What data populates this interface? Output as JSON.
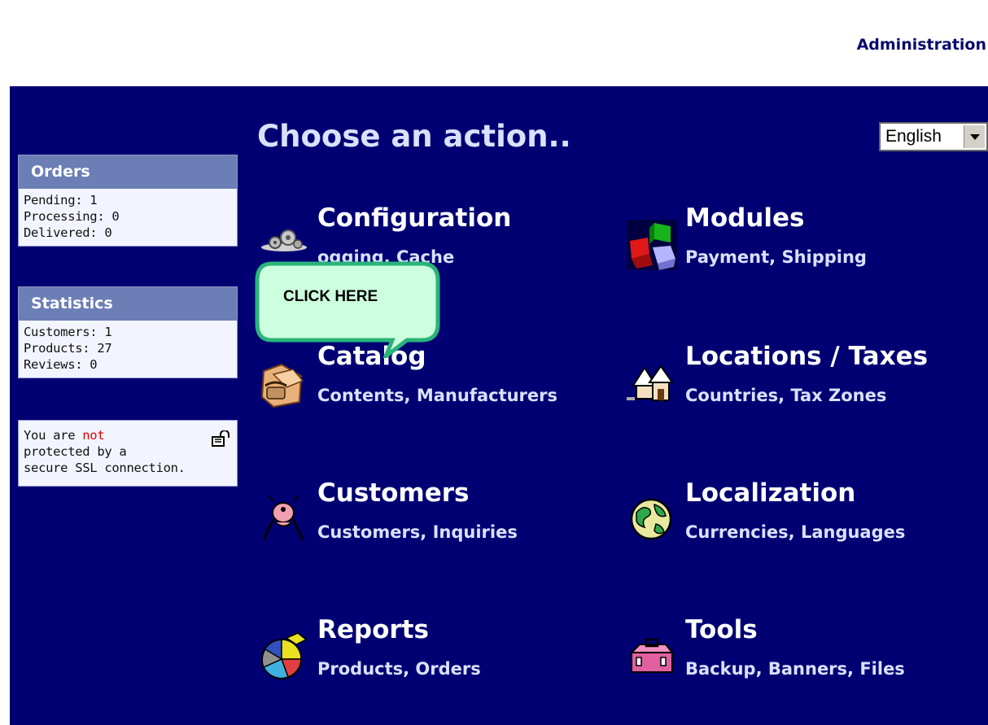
{
  "header": {
    "admin_link": "Administration"
  },
  "sidebar": {
    "orders": {
      "title": "Orders",
      "lines": [
        "Pending: 1",
        "Processing: 0",
        "Delivered: 0"
      ]
    },
    "statistics": {
      "title": "Statistics",
      "lines": [
        "Customers: 1",
        "Products: 27",
        "Reviews: 0"
      ]
    },
    "ssl": {
      "part1": "You are ",
      "not": "not",
      "part2": "protected by a",
      "part3": "secure SSL connection.",
      "icon": "unlocked-padlock-icon"
    }
  },
  "main": {
    "heading": "Choose an action..",
    "language": {
      "selected": "English"
    },
    "tooltip": "CLICK HERE",
    "actions": [
      {
        "title": "Configuration",
        "subtitle": "ogging, Cache",
        "icon": "gears-icon"
      },
      {
        "title": "Modules",
        "subtitle": "Payment, Shipping",
        "icon": "blocks-icon"
      },
      {
        "title": "Catalog",
        "subtitle": "Contents, Manufacturers",
        "icon": "folder-phone-icon"
      },
      {
        "title": "Locations / Taxes",
        "subtitle": "Countries, Tax Zones",
        "icon": "houses-icon"
      },
      {
        "title": "Customers",
        "subtitle": "Customers, Inquiries",
        "icon": "customer-figure-icon"
      },
      {
        "title": "Localization",
        "subtitle": "Currencies, Languages",
        "icon": "globe-icon"
      },
      {
        "title": "Reports",
        "subtitle": "Products, Orders",
        "icon": "pie-chart-icon"
      },
      {
        "title": "Tools",
        "subtitle": "Backup, Banners, Files",
        "icon": "toolbox-icon"
      }
    ]
  },
  "colors": {
    "main_bg": "#000073",
    "box_header": "#6c7eb6",
    "heading_text": "#d9e1ff",
    "tooltip_fill": "#ccffdd",
    "tooltip_border": "#2ab37a",
    "warning_red": "#e00000"
  }
}
